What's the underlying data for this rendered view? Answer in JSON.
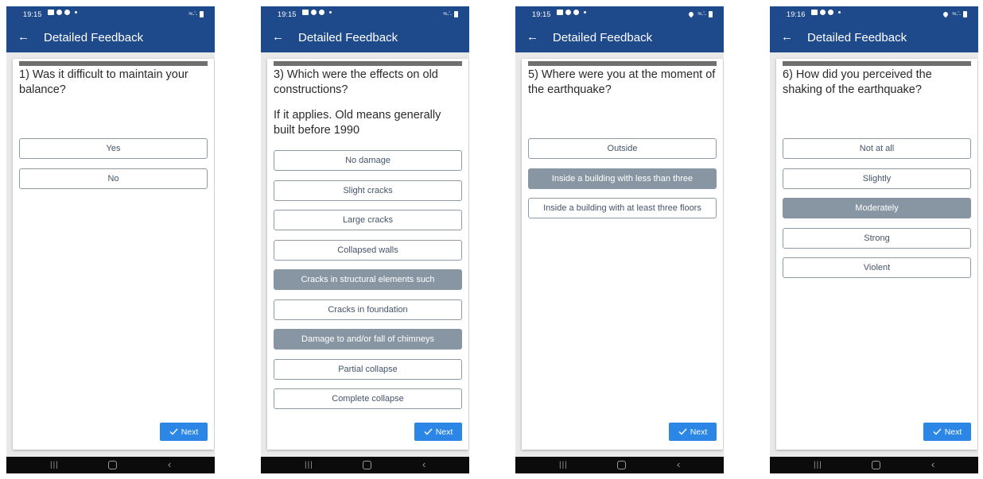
{
  "screens": [
    {
      "status_time": "19:15",
      "show_location": false,
      "header_title": "Detailed Feedback",
      "question": "1) Was it difficult to maintain your balance?",
      "note": "",
      "options": [
        {
          "label": "Yes",
          "selected": false
        },
        {
          "label": "No",
          "selected": false
        }
      ],
      "next_label": "Next"
    },
    {
      "status_time": "19:15",
      "show_location": false,
      "header_title": "Detailed Feedback",
      "question": "3) Which were the effects on old constructions?",
      "note": "If it applies. Old means generally built before 1990",
      "options": [
        {
          "label": "No damage",
          "selected": false
        },
        {
          "label": "Slight cracks",
          "selected": false
        },
        {
          "label": "Large cracks",
          "selected": false
        },
        {
          "label": "Collapsed walls",
          "selected": false
        },
        {
          "label": "Cracks in structural elements such",
          "selected": true
        },
        {
          "label": "Cracks in foundation",
          "selected": false
        },
        {
          "label": "Damage to and/or fall of chimneys",
          "selected": true
        },
        {
          "label": "Partial collapse",
          "selected": false
        },
        {
          "label": "Complete collapse",
          "selected": false
        }
      ],
      "next_label": "Next"
    },
    {
      "status_time": "19:15",
      "show_location": true,
      "header_title": "Detailed Feedback",
      "question": "5) Where were you at the moment of the earthquake?",
      "note": "",
      "options": [
        {
          "label": "Outside",
          "selected": false
        },
        {
          "label": "Inside a building with less than three",
          "selected": true
        },
        {
          "label": "Inside a building with at least three floors",
          "selected": false
        }
      ],
      "next_label": "Next"
    },
    {
      "status_time": "19:16",
      "show_location": true,
      "header_title": "Detailed Feedback",
      "question": "6) How did you perceived the shaking of the earthquake?",
      "note": "",
      "options": [
        {
          "label": "Not at all",
          "selected": false
        },
        {
          "label": "Slightly",
          "selected": false
        },
        {
          "label": "Moderately",
          "selected": true
        },
        {
          "label": "Strong",
          "selected": false
        },
        {
          "label": "Violent",
          "selected": false
        }
      ],
      "next_label": "Next"
    }
  ],
  "icons": {
    "back": "arrow-left-icon",
    "next": "check-icon",
    "nav_recent": "recent-apps-icon",
    "nav_home": "home-icon",
    "nav_back": "chevron-left-icon"
  },
  "colors": {
    "appbar": "#1e4a8b",
    "selected_option": "#8896a3",
    "next_button": "#2b86e5"
  }
}
